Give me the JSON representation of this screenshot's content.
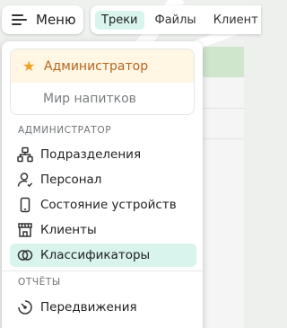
{
  "header": {
    "menu_label": "Меню",
    "tabs": [
      {
        "label": "Треки",
        "active": true
      },
      {
        "label": "Файлы",
        "active": false
      },
      {
        "label": "Клиент",
        "active": false
      }
    ]
  },
  "roles": {
    "current": "Администратор",
    "other": "Мир напитков"
  },
  "sections": {
    "admin_title": "АДМИНИСТРАТОР",
    "reports_title": "ОТЧЁТЫ"
  },
  "menu_items": [
    {
      "label": "Подразделения",
      "icon": "org-chart-icon"
    },
    {
      "label": "Персонал",
      "icon": "person-icon"
    },
    {
      "label": "Состояние устройств",
      "icon": "phone-icon"
    },
    {
      "label": "Клиенты",
      "icon": "store-icon"
    },
    {
      "label": "Классификаторы",
      "icon": "circles-icon",
      "active": true
    }
  ],
  "report_items": [
    {
      "label": "Передвижения",
      "icon": "gauge-icon"
    }
  ],
  "colors": {
    "accent": "#d8f4ec",
    "role_highlight": "#fff6e4",
    "role_text": "#b5651d",
    "star": "#f0a020"
  }
}
